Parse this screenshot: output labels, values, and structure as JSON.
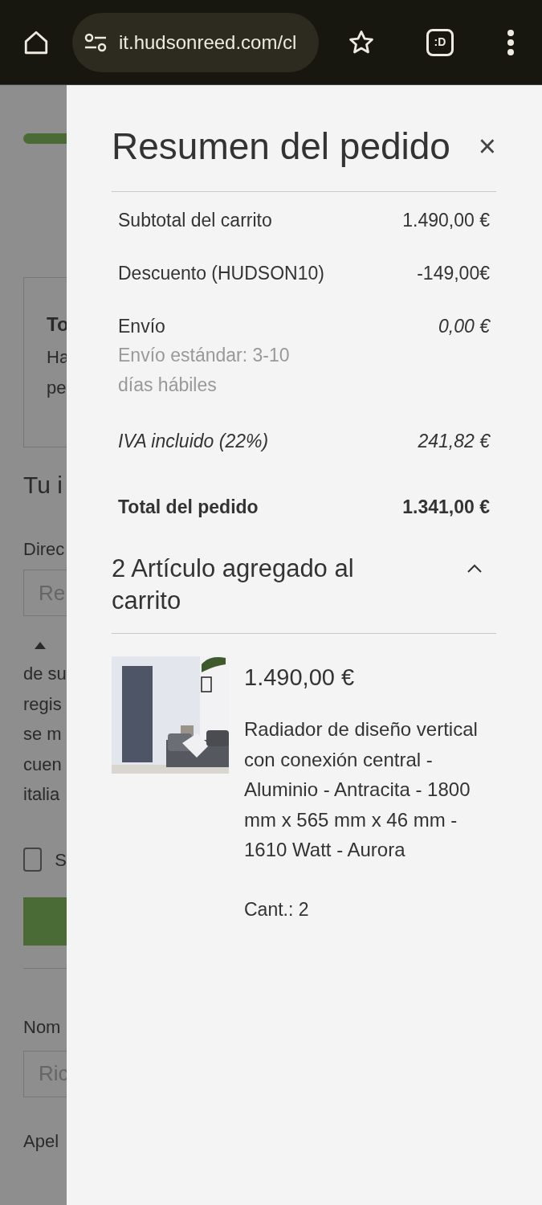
{
  "browser": {
    "url": "it.hudsonreed.com/cl",
    "tab_badge": ":D"
  },
  "background": {
    "notice": {
      "title": "To",
      "lines": [
        "Ha",
        "pe"
      ]
    },
    "heading": "Tu i",
    "address_label": "Direc",
    "address_placeholder": "Re",
    "note_lines": [
      "de su",
      "regis",
      "se m",
      "cuen",
      "italia"
    ],
    "checkbox": {
      "label": "S",
      "checked": false
    },
    "name_label": "Nom",
    "name_placeholder": "Ric",
    "surname_label": "Apel"
  },
  "summary": {
    "title": "Resumen del pedido",
    "close": "×",
    "rows": [
      {
        "kind": "plain",
        "label": "Subtotal del carrito",
        "value": "1.490,00 €"
      },
      {
        "kind": "plain",
        "label": "Descuento (HUDSON10)",
        "value": "-149,00€"
      },
      {
        "kind": "shipping",
        "label": "Envío",
        "value": "0,00 €",
        "note": "Envío estándar: 3-10 días hábiles"
      },
      {
        "kind": "italic",
        "label": "IVA incluido (22%)",
        "value": "241,82 €"
      },
      {
        "kind": "total",
        "label": "Total del pedido",
        "value": "1.341,00 €"
      }
    ],
    "items_header": {
      "text": "2 Artículo agregado al carrito",
      "expanded": true
    },
    "items": [
      {
        "price": "1.490,00 €",
        "description": "Radiador de diseño vertical con conexión central - Aluminio - Antracita - 1800 mm x 565 mm x 46 mm - 1610 Watt - Aurora",
        "quantity": "Cant.: 2"
      }
    ]
  }
}
